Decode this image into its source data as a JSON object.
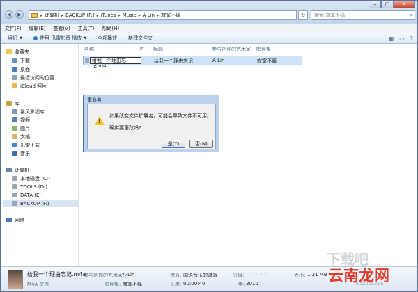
{
  "address": {
    "segments": [
      "计算机",
      "BACKUP (F:)",
      "iTunes",
      "Music",
      "A-Lin",
      "寂寞不痛"
    ],
    "search_placeholder": "搜索 寂寞不痛"
  },
  "caption": {
    "minimize": "–",
    "maximize": "□",
    "close": "✕"
  },
  "menubar": {
    "items": [
      "文件(F)",
      "编辑(E)",
      "查看(V)",
      "工具(T)",
      "帮助(H)"
    ]
  },
  "toolbar": {
    "organize": "组织",
    "play_with": "使用 迅雷影音 播放",
    "play_all": "全部播放",
    "new_folder": "新建文件夹"
  },
  "navpane": {
    "favorites": "收藏夹",
    "downloads": "下载",
    "desktop": "桌面",
    "recent": "最近访问的位置",
    "icloud": "iCloud 照片",
    "libraries": "库",
    "baofeng": "暴风影视库",
    "videos": "视频",
    "pictures": "图片",
    "documents": "文档",
    "xunlei": "迅雷下载",
    "music": "音乐",
    "computer": "计算机",
    "local_disk": "本地磁盘 (C:)",
    "tools": "TOOLS (D:)",
    "data": "DATA (E:)",
    "backup": "BACKUP (F:)",
    "network": "网络"
  },
  "columns": {
    "name": "名称",
    "number": "#",
    "title": "标题",
    "artist": "参与创作的艺术家",
    "album": "唱片集"
  },
  "file": {
    "rename_value": "给我一个理由忘记.m4r",
    "title": "给我一个理由忘记",
    "artist": "A-Lin",
    "album": "寂寞不痛"
  },
  "dialog": {
    "title": "重命名",
    "message1": "如果改变文件扩展名，可能会导致文件不可用。",
    "message2": "确实要更改吗?",
    "yes": "是(Y)",
    "no": "否(N)"
  },
  "details": {
    "filename": "给我一个理由忘记.m4a",
    "filetype": "M4A 文件",
    "artist_label": "参与创作的艺术家:",
    "artist": "A-Lin",
    "album_label": "唱片集:",
    "album": "寂寞不痛",
    "genre_label": "流派:",
    "genre": "国语音乐的流派",
    "length_label": "长度:",
    "length": "00:00:40",
    "rating_label": "分级:",
    "rating_stars": "☆☆☆☆☆",
    "year_label": "年:",
    "year": "2010",
    "size_label": "大小:",
    "size": "1.31 MB"
  },
  "watermark": {
    "main": "云南龙网",
    "top": "下载吧",
    "sub": "xiazaiba.com"
  }
}
